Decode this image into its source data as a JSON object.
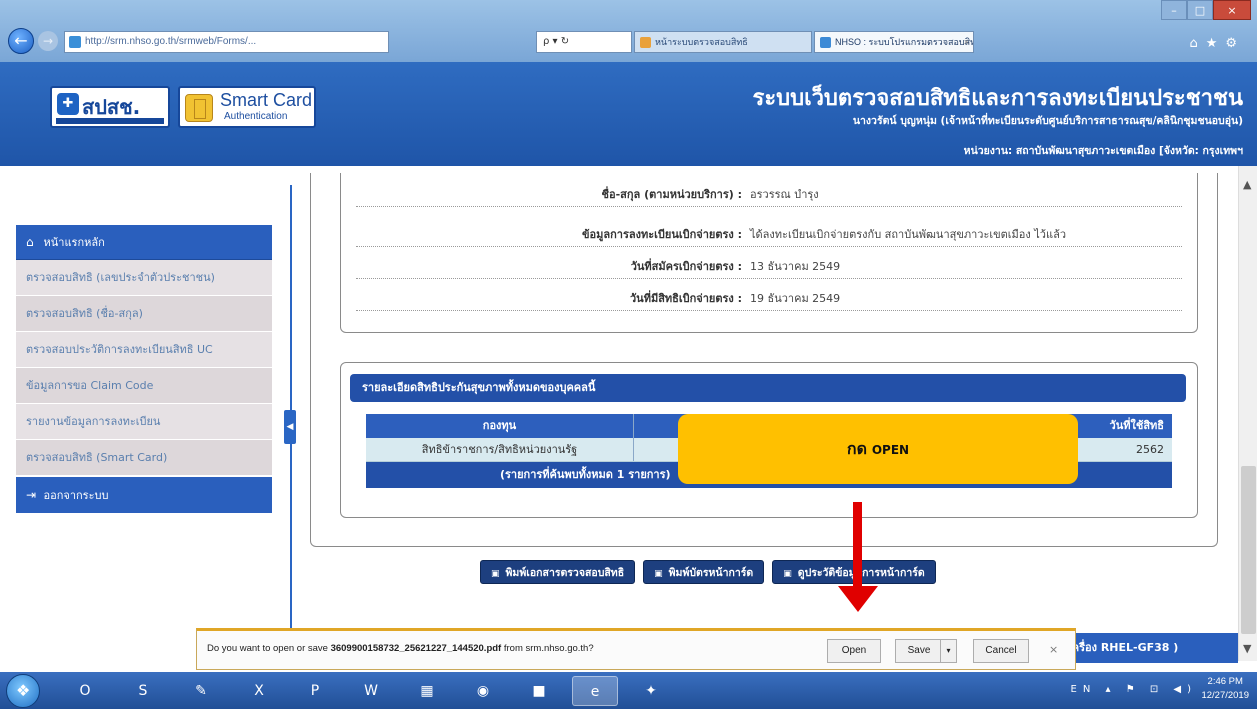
{
  "browser": {
    "address": "http://srm.nhso.go.th/srmweb/Forms/...",
    "address_tools": "ρ ▾ ↻",
    "tabs": [
      {
        "label": "หน้าระบบตรวจสอบสิทธิ"
      },
      {
        "label": "NHSO : ระบบโปรแกรมตรวจสอบสิทธิ..."
      }
    ],
    "tab_close": "×",
    "win_min": "–",
    "win_max": "□",
    "win_close": "×",
    "chrome_icons": "⌂★⚙"
  },
  "header": {
    "logo_nhso": "สปสช.",
    "logo_sc_title": "Smart Card",
    "logo_sc_sub": "Authentication",
    "title": "ระบบเว็บตรวจสอบสิทธิและการลงทะเบียนประชาชน",
    "user": "นางวรัตน์ บุญหนุ่ม (เจ้าหน้าที่ทะเบียนระดับศูนย์บริการสาธารณสุข/คลินิกชุมชนอบอุ่น)",
    "unit": "หน่วยงาน: สถาบันพัฒนาสุขภาวะเขตเมือง [จังหวัด: กรุงเทพฯ"
  },
  "sidebar": {
    "home": "หน้าแรกหลัก",
    "items": [
      {
        "label": "ตรวจสอบสิทธิ (เลขประจำตัวประชาชน)"
      },
      {
        "label": "ตรวจสอบสิทธิ (ชื่อ-สกุล)"
      },
      {
        "label": "ตรวจสอบประวัติการลงทะเบียนสิทธิ UC"
      },
      {
        "label": "ข้อมูลการขอ Claim Code"
      },
      {
        "label": "รายงานข้อมูลการลงทะเบียน"
      },
      {
        "label": "ตรวจสอบสิทธิ (Smart Card)"
      }
    ],
    "logout": "ออกจากระบบ",
    "collapse": "◀"
  },
  "info": {
    "rows": [
      {
        "label": "ชื่อ-สกุล (ตามหน่วยบริการ) :",
        "value": "อรวรรณ บำรุง"
      },
      {
        "label": "ข้อมูลการลงทะเบียนเบิกจ่ายตรง :",
        "value": "ได้ลงทะเบียนเบิกจ่ายตรงกับ สถาบันพัฒนาสุขภาวะเขตเมือง ไว้แล้ว"
      },
      {
        "label": "วันที่สมัครเบิกจ่ายตรง :",
        "value": "13 ธันวาคม 2549"
      },
      {
        "label": "วันที่มีสิทธิเบิกจ่ายตรง :",
        "value": "19 ธันวาคม 2549"
      }
    ]
  },
  "rights": {
    "heading": "รายละเอียดสิทธิประกันสุขภาพทั้งหมดของบุคคลนี้",
    "columns": [
      "กองทุน",
      "",
      "วันที่ใช้สิทธิ"
    ],
    "rows": [
      {
        "fund": "สิทธิข้าราชการ/สิทธิหน่วยงานรัฐ",
        "c2": "",
        "c3": "2562"
      }
    ],
    "footer": "(รายการที่ค้นพบทั้งหมด 1 รายการ)"
  },
  "actions": {
    "print_doc": "พิมพ์เอกสารตรวจสอบสิทธิ",
    "print_card": "พิมพ์บัตรหน้าการ์ด",
    "history": "ดูประวัติข้อมูลการหน้าการ์ด"
  },
  "footer_bar": "เครื่อง RHEL-GF38 )",
  "download": {
    "prefix": "Do you want to open or save ",
    "filename": "3609900158732_25621227_144520.pdf",
    "suffix": " from srm.nhso.go.th?",
    "open": "Open",
    "save": "Save",
    "save_dd": "▾",
    "cancel": "Cancel",
    "close": "×"
  },
  "overlay": {
    "callout_thai": "กด",
    "callout_en": "OPEN",
    "arrow_color": "#e00000",
    "callout_color": "#ffc000"
  },
  "taskbar": {
    "apps": [
      {
        "icon": "O"
      },
      {
        "icon": "S"
      },
      {
        "icon": "✎"
      },
      {
        "icon": "X"
      },
      {
        "icon": "P"
      },
      {
        "icon": "W"
      },
      {
        "icon": "▦"
      },
      {
        "icon": "◉"
      },
      {
        "icon": "■"
      },
      {
        "icon": "e"
      },
      {
        "icon": "✦"
      }
    ],
    "tray": "EN ▴ ⚑ ⊡ ◀)",
    "time": "2:46 PM",
    "date": "12/27/2019"
  },
  "colors": {
    "header_blue": "#2a5fbd",
    "sidebar_item_bg": "#e6e1e4",
    "table_row_bg": "#d8eaf0"
  }
}
